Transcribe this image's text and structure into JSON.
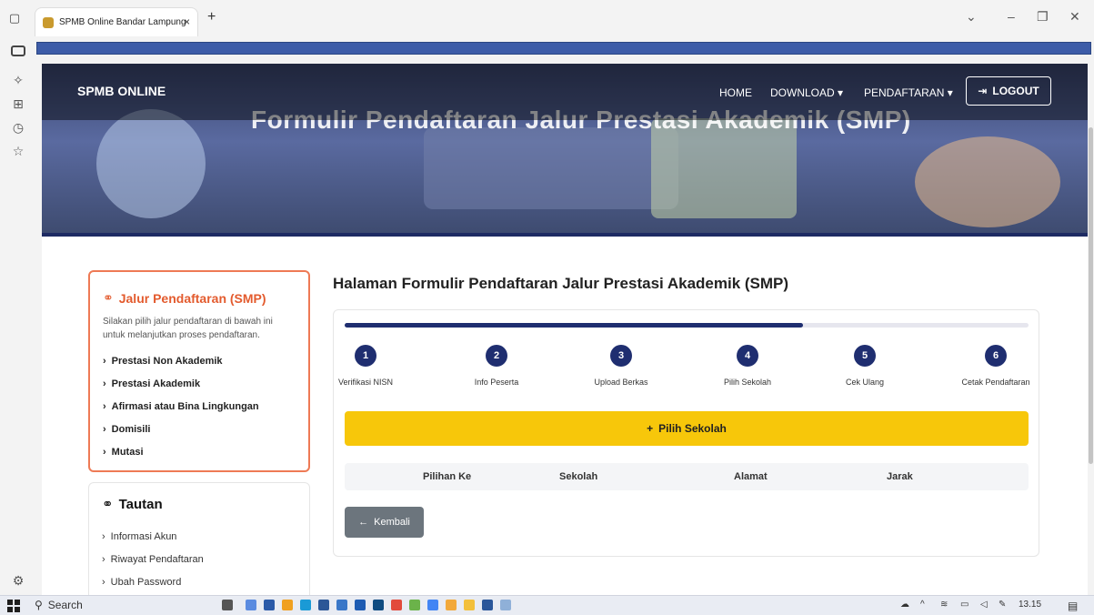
{
  "browser": {
    "tab_title": "SPMB Online Bandar Lampung",
    "tab_close": "×",
    "new_tab": "+",
    "controls": {
      "chevron": "⌄",
      "minimize": "–",
      "restore": "❐",
      "close": "✕"
    }
  },
  "nav": {
    "brand": "SPMB ONLINE",
    "items": [
      "HOME",
      "DOWNLOAD ▾",
      "PENDAFTARAN ▾"
    ],
    "logout_label": "LOGOUT"
  },
  "hero": {
    "title": "Formulir Pendaftaran Jalur Prestasi Akademik (SMP)"
  },
  "sidebar": {
    "title": "Jalur Pendaftaran (SMP)",
    "desc": "Silakan pilih jalur pendaftaran di bawah ini untuk melanjutkan proses pendaftaran.",
    "items": [
      "Prestasi Non Akademik",
      "Prestasi Akademik",
      "Afirmasi atau Bina Lingkungan",
      "Domisili",
      "Mutasi"
    ]
  },
  "links": {
    "title": "Tautan",
    "items": [
      "Informasi Akun",
      "Riwayat Pendaftaran",
      "Ubah Password"
    ]
  },
  "main": {
    "title": "Halaman Formulir Pendaftaran Jalur Prestasi Akademik (SMP)",
    "progress_fraction": 0.67,
    "steps": [
      {
        "num": "1",
        "label": "Verifikasi NISN"
      },
      {
        "num": "2",
        "label": "Info Peserta"
      },
      {
        "num": "3",
        "label": "Upload Berkas"
      },
      {
        "num": "4",
        "label": "Pilih Sekolah"
      },
      {
        "num": "5",
        "label": "Cek Ulang"
      },
      {
        "num": "6",
        "label": "Cetak Pendaftaran"
      }
    ],
    "pilih_label": "Pilih Sekolah",
    "table_headers": [
      "Pilihan Ke",
      "Sekolah",
      "Alamat",
      "Jarak"
    ],
    "back_label": "Kembali"
  },
  "taskbar": {
    "search_label": "Search",
    "time": "13.15"
  },
  "colors": {
    "navy": "#1f2e70",
    "orange": "#e35b2e",
    "yellow": "#f7c70a"
  }
}
